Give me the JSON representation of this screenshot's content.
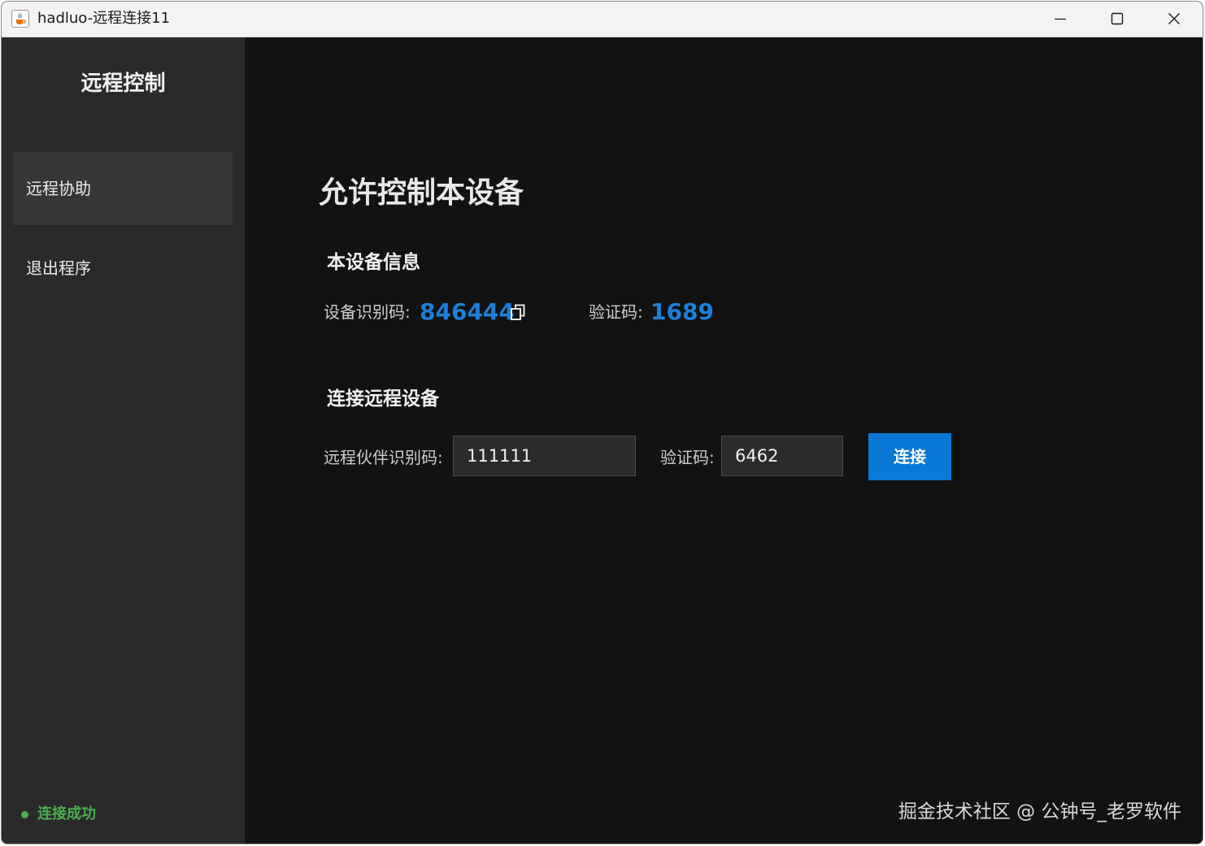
{
  "window": {
    "title": "hadluo-远程连接11",
    "app_icon": "java-cup-icon"
  },
  "sidebar": {
    "title": "远程控制",
    "items": [
      {
        "label": "远程协助",
        "active": true
      },
      {
        "label": "退出程序",
        "active": false
      }
    ],
    "status": {
      "text": "连接成功",
      "color": "#4caf50"
    }
  },
  "main": {
    "page_title": "允许控制本设备",
    "device_info": {
      "section_title": "本设备信息",
      "id_label": "设备识别码:",
      "id_value": "846444",
      "code_label": "验证码:",
      "code_value": "1689"
    },
    "connect": {
      "section_title": "连接远程设备",
      "partner_label": "远程伙伴识别码:",
      "partner_value": "111111",
      "code_label": "验证码:",
      "code_value": "6462",
      "button_label": "连接"
    },
    "watermark": "掘金技术社区 @ 公钟号_老罗软件"
  },
  "colors": {
    "accent": "#0a78d4",
    "value_blue": "#1e7fd8",
    "sidebar_bg": "#2a2a2a",
    "main_bg": "#121212"
  }
}
